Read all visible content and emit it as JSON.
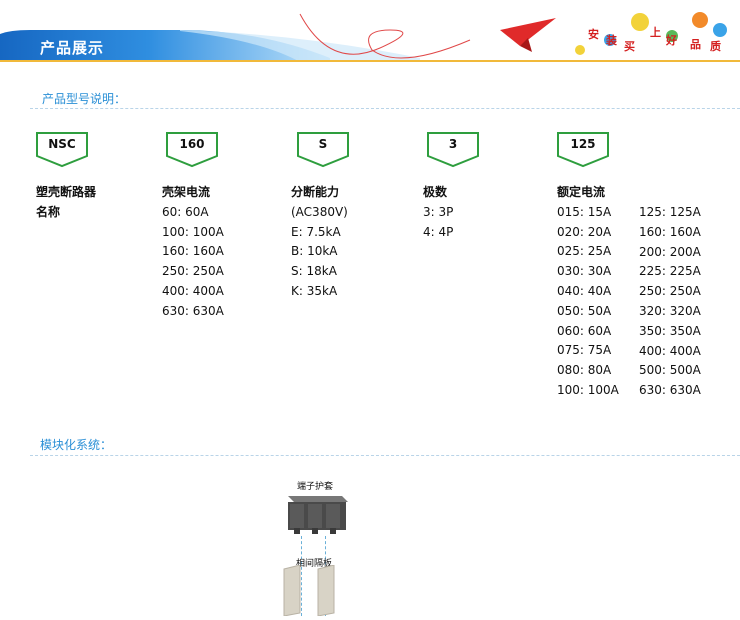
{
  "header": {
    "title": "产品展示",
    "slogan_chars": [
      "安",
      "装",
      "买",
      "上",
      "好",
      "品",
      "质"
    ],
    "colors": {
      "bar": "#1a6fc8",
      "bar_light": "#5bb6ee",
      "accent_plane": "#e02a2a"
    }
  },
  "model_section": {
    "title": "产品型号说明："
  },
  "codes": [
    {
      "code": "NSC",
      "title": "塑壳断路器",
      "lines": [
        "名称"
      ]
    },
    {
      "code": "160",
      "title": "壳架电流",
      "lines": [
        "60: 60A",
        "100: 100A",
        "160: 160A",
        "250: 250A",
        "400: 400A",
        "630: 630A"
      ]
    },
    {
      "code": "S",
      "title": "分断能力",
      "lines": [
        "(AC380V)",
        "E: 7.5kA",
        "B: 10kA",
        "S: 18kA",
        "K: 35kA"
      ]
    },
    {
      "code": "3",
      "title": "极数",
      "lines": [
        "3: 3P",
        "4: 4P"
      ]
    },
    {
      "code": "125",
      "title": "额定电流",
      "lines_a": [
        "015: 15A",
        "020: 20A",
        "025: 25A",
        "030: 30A",
        "040: 40A",
        "050: 50A",
        "060: 60A",
        "075: 75A",
        "080: 80A",
        "100: 100A"
      ],
      "lines_b": [
        "125: 125A",
        "160: 160A",
        "200: 200A",
        "225: 225A",
        "250: 250A",
        "320: 320A",
        "350: 350A",
        "400: 400A",
        "500: 500A",
        "630: 630A"
      ]
    }
  ],
  "module_section": {
    "title": "模块化系统：",
    "labels": {
      "terminal_cover": "端子护套",
      "phase_barrier": "相间隔板"
    }
  },
  "colors": {
    "code_border": "#2e9e3e",
    "section_title": "#2a8fd6"
  }
}
